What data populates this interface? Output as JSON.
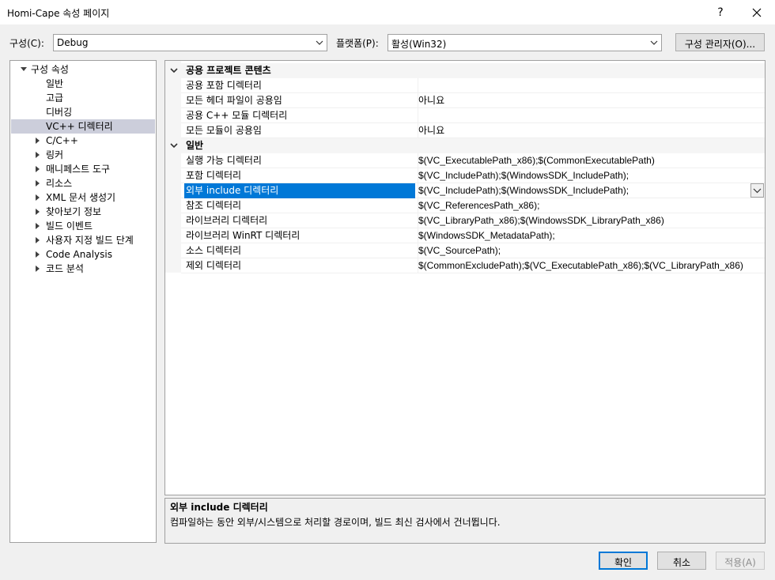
{
  "window": {
    "title": "Homi-Cape 속성 페이지",
    "help_label": "?",
    "close_label": "✕"
  },
  "toolbar": {
    "config_label": "구성(C):",
    "config_value": "Debug",
    "platform_label": "플랫폼(P):",
    "platform_value": "활성(Win32)",
    "config_manager_label": "구성 관리자(O)..."
  },
  "tree": {
    "root": "구성 속성",
    "items": [
      {
        "label": "일반"
      },
      {
        "label": "고급"
      },
      {
        "label": "디버깅"
      },
      {
        "label": "VC++ 디렉터리"
      },
      {
        "label": "C/C++"
      },
      {
        "label": "링커"
      },
      {
        "label": "매니페스트 도구"
      },
      {
        "label": "리소스"
      },
      {
        "label": "XML 문서 생성기"
      },
      {
        "label": "찾아보기 정보"
      },
      {
        "label": "빌드 이벤트"
      },
      {
        "label": "사용자 지정 빌드 단계"
      },
      {
        "label": "Code Analysis"
      },
      {
        "label": "코드 분석"
      }
    ]
  },
  "grid": {
    "categories": [
      {
        "label": "공용 프로젝트 콘텐츠"
      },
      {
        "label": "일반"
      }
    ],
    "rows": [
      {
        "name": "공용 포함 디렉터리",
        "value": ""
      },
      {
        "name": "모든 헤더 파일이 공용임",
        "value": "아니요"
      },
      {
        "name": "공용 C++ 모듈 디렉터리",
        "value": ""
      },
      {
        "name": "모든 모듈이 공용임",
        "value": "아니요"
      },
      {
        "name": "실행 가능 디렉터리",
        "value": "$(VC_ExecutablePath_x86);$(CommonExecutablePath)"
      },
      {
        "name": "포함 디렉터리",
        "value": "$(VC_IncludePath);$(WindowsSDK_IncludePath);"
      },
      {
        "name": "외부 include 디렉터리",
        "value": "$(VC_IncludePath);$(WindowsSDK_IncludePath);"
      },
      {
        "name": "참조 디렉터리",
        "value": "$(VC_ReferencesPath_x86);"
      },
      {
        "name": "라이브러리 디렉터리",
        "value": "$(VC_LibraryPath_x86);$(WindowsSDK_LibraryPath_x86)"
      },
      {
        "name": "라이브러리 WinRT 디렉터리",
        "value": "$(WindowsSDK_MetadataPath);"
      },
      {
        "name": "소스 디렉터리",
        "value": "$(VC_SourcePath);"
      },
      {
        "name": "제외 디렉터리",
        "value": "$(CommonExcludePath);$(VC_ExecutablePath_x86);$(VC_LibraryPath_x86)"
      }
    ]
  },
  "description": {
    "title": "외부 include 디렉터리",
    "text": "컴파일하는 동안 외부/시스템으로 처리할 경로이며, 빌드 최신 검사에서 건너뜁니다."
  },
  "buttons": {
    "ok": "확인",
    "cancel": "취소",
    "apply": "적용(A)"
  },
  "colors": {
    "selection": "#0078d7",
    "tree_selection": "#cccedb"
  }
}
